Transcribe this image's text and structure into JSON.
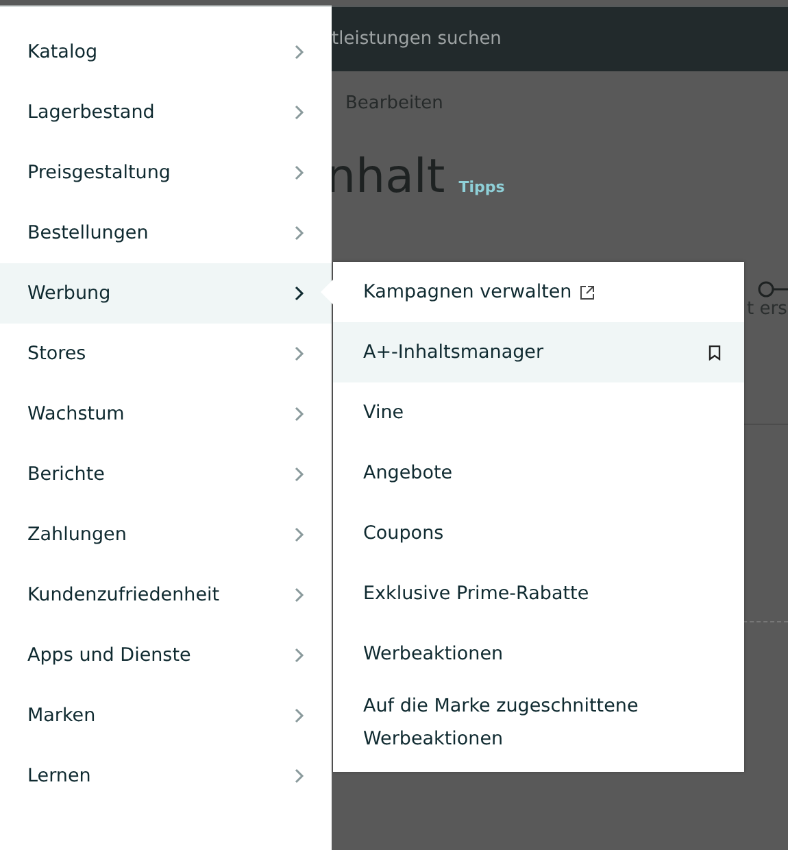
{
  "page": {
    "search_text": "tleistungen suchen",
    "breadcrumb": "Bearbeiten",
    "heading": "nhalt",
    "heading_link": "Tipps",
    "step_label": "t ers"
  },
  "menu": {
    "items": [
      {
        "label": "Katalog",
        "selected": false
      },
      {
        "label": "Lagerbestand",
        "selected": false
      },
      {
        "label": "Preisgestaltung",
        "selected": false
      },
      {
        "label": "Bestellungen",
        "selected": false
      },
      {
        "label": "Werbung",
        "selected": true
      },
      {
        "label": "Stores",
        "selected": false
      },
      {
        "label": "Wachstum",
        "selected": false
      },
      {
        "label": "Berichte",
        "selected": false
      },
      {
        "label": "Zahlungen",
        "selected": false
      },
      {
        "label": "Kundenzufriedenheit",
        "selected": false
      },
      {
        "label": "Apps und Dienste",
        "selected": false
      },
      {
        "label": "Marken",
        "selected": false
      },
      {
        "label": "Lernen",
        "selected": false
      }
    ]
  },
  "submenu": {
    "items": [
      {
        "label": "Kampagnen verwalten",
        "selected": false,
        "kind": "external"
      },
      {
        "label": "A+-Inhaltsmanager",
        "selected": true,
        "kind": "bookmark"
      },
      {
        "label": "Vine",
        "selected": false,
        "kind": "plain"
      },
      {
        "label": "Angebote",
        "selected": false,
        "kind": "plain"
      },
      {
        "label": "Coupons",
        "selected": false,
        "kind": "plain"
      },
      {
        "label": "Exklusive Prime-Rabatte",
        "selected": false,
        "kind": "plain"
      },
      {
        "label": "Werbeaktionen",
        "selected": false,
        "kind": "plain"
      },
      {
        "label": "Auf die Marke zugeschnittene Werbeaktionen",
        "selected": false,
        "kind": "plain"
      }
    ]
  }
}
